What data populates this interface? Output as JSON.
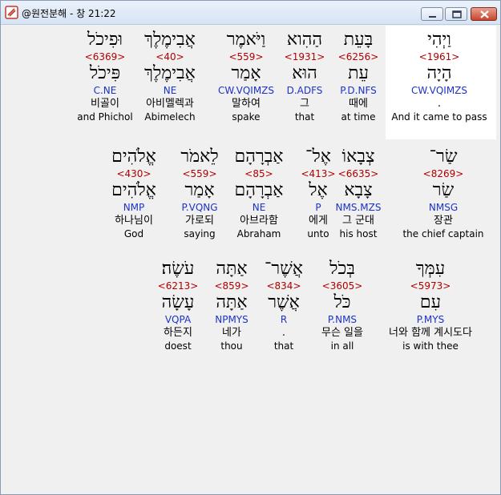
{
  "window": {
    "title": "@원전분해 - 창 21:22",
    "minimize_label": "",
    "maximize_label": "",
    "close_label": ""
  },
  "colors": {
    "strong_number": "#b00000",
    "parse_code": "#1a33c8",
    "highlight_bg": "#ffffff",
    "window_bg": "#f0f0f0"
  },
  "lines": [
    {
      "words": [
        {
          "hebrew": "וַיְהִי",
          "strong": "<1961>",
          "root": "הָיָה",
          "parse": "CW.VQIMZS",
          "korean": ".",
          "english": "And it came to pass"
        },
        {
          "hebrew": "בָּעֵת",
          "strong": "<6256>",
          "root": "עֵת",
          "parse": "P.D.NFS",
          "korean": "때에",
          "english": "at time"
        },
        {
          "hebrew": "הַהִוא",
          "strong": "<1931>",
          "root": "הוּא",
          "parse": "D.ADFS",
          "korean": "그",
          "english": "that"
        },
        {
          "hebrew": "וַיֹּאמֶר",
          "strong": "<559>",
          "root": "אָמַר",
          "parse": "CW.VQIMZS",
          "korean": "말하여",
          "english": "spake"
        },
        {
          "hebrew": "אֲבִימֶלֶךְ",
          "strong": "<40>",
          "root": "אֲבִימֶלֶךְ",
          "parse": "NE",
          "korean": "아비멜렉과",
          "english": "Abimelech"
        },
        {
          "hebrew": "וּפִיכֹל",
          "strong": "<6369>",
          "root": "פִּיכֹל",
          "parse": "C.NE",
          "korean": "비골이",
          "english": "and Phichol"
        }
      ]
    },
    {
      "words": [
        {
          "hebrew": "שַׂר־",
          "strong": "<8269>",
          "root": "שַׂר",
          "parse": "NMSG",
          "korean": "장관",
          "english": "the chief captain"
        },
        {
          "hebrew": "צְבָאוֹ",
          "strong": "<6635>",
          "root": "צָבָא",
          "parse": "NMS.MZS",
          "korean": "그 군대",
          "english": "his host"
        },
        {
          "hebrew": "אֶל־",
          "strong": "<413>",
          "root": "אֶל",
          "parse": "P",
          "korean": "에게",
          "english": "unto"
        },
        {
          "hebrew": "אַבְרָהָם",
          "strong": "<85>",
          "root": "אַבְרָהָם",
          "parse": "NE",
          "korean": "아브라함",
          "english": "Abraham"
        },
        {
          "hebrew": "לֵאמֹר",
          "strong": "<559>",
          "root": "אָמַר",
          "parse": "P.VQNG",
          "korean": "가로되",
          "english": "saying"
        },
        {
          "hebrew": "אֱלֹהִים",
          "strong": "<430>",
          "root": "אֱלֹהִים",
          "parse": "NMP",
          "korean": "하나님이",
          "english": "God"
        }
      ]
    },
    {
      "words": [
        {
          "hebrew": "עִמְּךָ",
          "strong": "<5973>",
          "root": "עִם",
          "parse": "P.MYS",
          "korean": "너와 함께 계시도다",
          "english": "is with thee"
        },
        {
          "hebrew": "בְּכֹל",
          "strong": "<3605>",
          "root": "כֹּל",
          "parse": "P.NMS",
          "korean": "무슨 일을",
          "english": "in all"
        },
        {
          "hebrew": "אֲשֶׁר־",
          "strong": "<834>",
          "root": "אֲשֶׁר",
          "parse": "R",
          "korean": ".",
          "english": "that"
        },
        {
          "hebrew": "אַתָּה",
          "strong": "<859>",
          "root": "אַתָּה",
          "parse": "NPMYS",
          "korean": "네가",
          "english": "thou"
        },
        {
          "hebrew": "עֹשֶׂה׃",
          "strong": "<6213>",
          "root": "עָשָׂה",
          "parse": "VQPA",
          "korean": "하든지",
          "english": "doest"
        }
      ]
    }
  ]
}
